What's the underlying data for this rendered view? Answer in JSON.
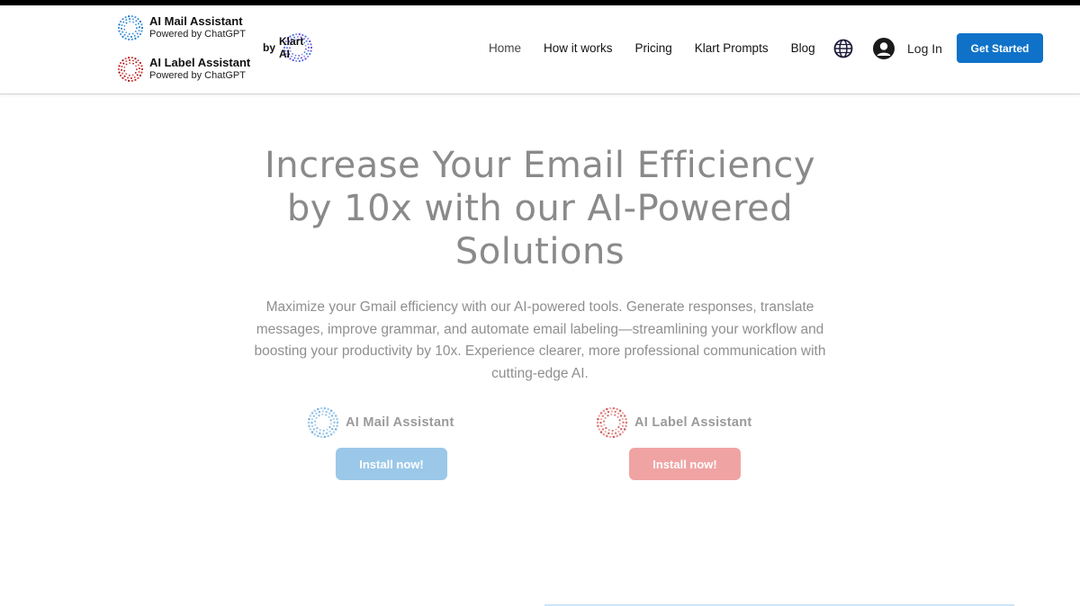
{
  "header": {
    "brand_mail": {
      "name": "AI Mail Assistant",
      "sub": "Powered by ChatGPT",
      "color": "#3a8fd8"
    },
    "brand_label": {
      "name": "AI Label Assistant",
      "sub": "Powered by ChatGPT",
      "color": "#c8282a"
    },
    "by_text": "by",
    "klart_logo_text": "Klart AI",
    "nav": [
      "Home",
      "How it works",
      "Pricing",
      "Klart Prompts",
      "Blog"
    ],
    "globe_icon": "globe-icon",
    "login_label": "Log In",
    "cta_label": "Get Started",
    "cta_color": "#0f72c8"
  },
  "hero": {
    "headline_lines": [
      "Increase Your Email Efficiency",
      "by 10x with our AI-Powered",
      "Solutions"
    ],
    "description_lines": [
      "Maximize your Gmail efficiency with our AI-powered tools. Generate responses, translate",
      "messages, improve grammar, and automate email labeling—streamlining your workflow and",
      "boosting your productivity by 10x. Experience clearer, more professional communication with",
      "cutting-edge AI."
    ]
  },
  "products": {
    "mail": {
      "name": "AI Mail Assistant",
      "button": "Install now!",
      "color": "#9bc8e8"
    },
    "label": {
      "name": "AI Label Assistant",
      "button": "Install now!",
      "color": "#f0a3a3"
    }
  }
}
